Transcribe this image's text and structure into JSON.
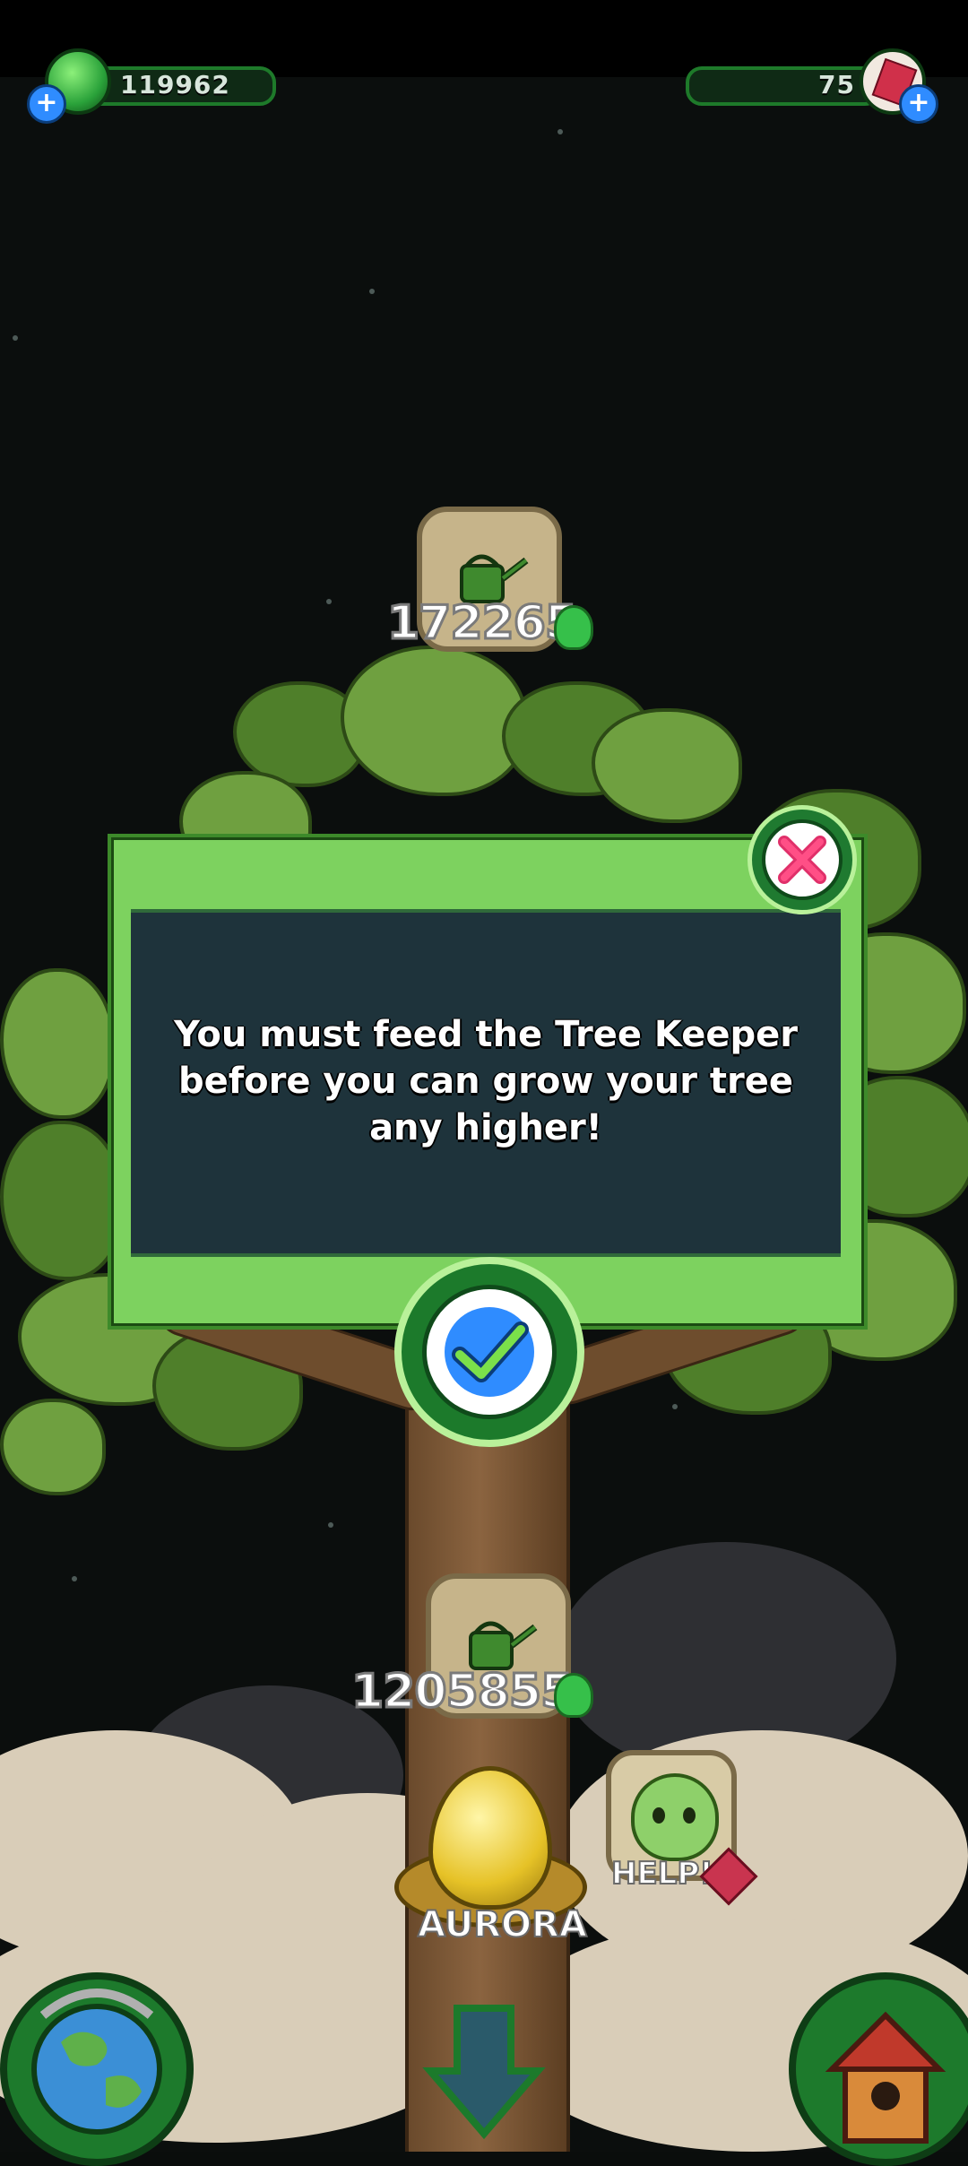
{
  "hud": {
    "coins": "119962",
    "gems": "75",
    "add_coins_label": "+",
    "add_gems_label": "+"
  },
  "rewards": [
    {
      "amount": "172265"
    },
    {
      "amount": "1205855"
    }
  ],
  "dialog": {
    "message": "You must feed the Tree Keeper before you can grow your tree any higher!"
  },
  "egg": {
    "name": "AURORA"
  },
  "helper": {
    "label": "HELP!"
  },
  "colors": {
    "dialog_bg": "#7dd25f",
    "dialog_panel": "#1e333b",
    "button_green": "#1c7a2b",
    "confirm_blue": "#2f8cff",
    "close_pink": "#e0306a"
  },
  "icons": {
    "coins": "green-gem-icon",
    "gems": "red-crystal-icon",
    "close": "close-x-icon",
    "confirm": "checkmark-icon",
    "reward": "watering-can-icon",
    "globe": "globe-icon",
    "house": "birdhouse-icon",
    "scroll_down": "down-arrow-icon"
  }
}
